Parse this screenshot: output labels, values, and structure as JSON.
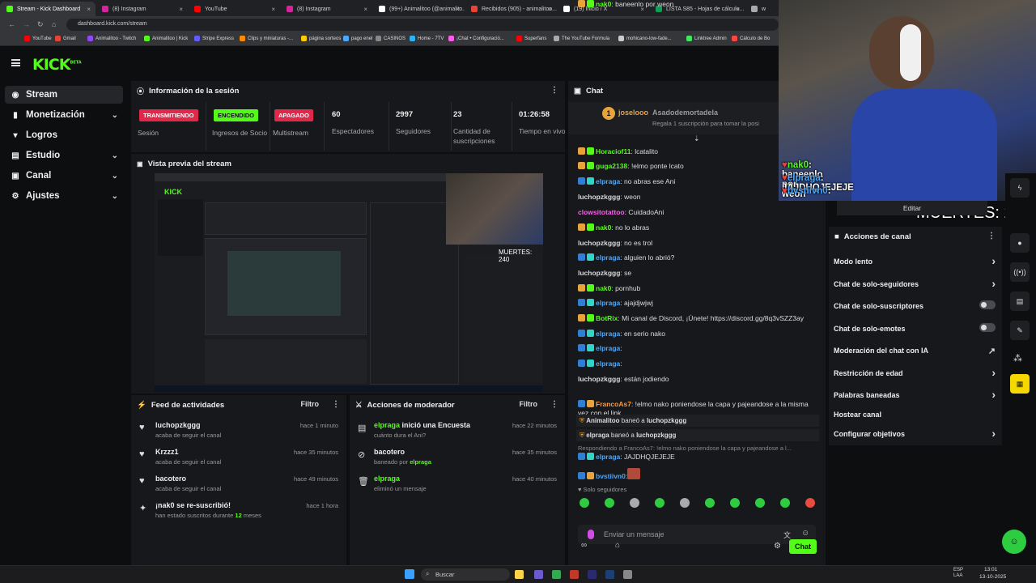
{
  "browser": {
    "tabs": [
      {
        "label": "Stream - Kick Dashboard",
        "color": "#53fc18"
      },
      {
        "label": "(8) Instagram",
        "color": "#d6249f"
      },
      {
        "label": "YouTube",
        "color": "#ff0000"
      },
      {
        "label": "(8) Instagram",
        "color": "#d6249f"
      },
      {
        "label": "(99+) Animalitoo (@animalito...",
        "color": "#ffffff"
      },
      {
        "label": "Recibidos (905) - animalitoo...",
        "color": "#ea4335"
      },
      {
        "label": "(19) Inicio / X",
        "color": "#ffffff"
      },
      {
        "label": "LISTA S85 - Hojas de cálculo...",
        "color": "#0f9d58"
      },
      {
        "label": "w",
        "color": "#aaaaaa"
      }
    ],
    "url": "dashboard.kick.com/stream",
    "bookmarks": [
      "YouTube",
      "Gmail",
      "Animalitoo - Twitch",
      "Animalitoo | Kick",
      "Stripe Express",
      "Clips y miniaturas -...",
      "página sorteos",
      "pago enel",
      "CASINOS",
      "Home - 7TV",
      "¡Chat • Configuració...",
      "Superfans",
      "The YouTube Formula",
      "mohicano-low-fade...",
      "Linktree Admin",
      "Cálculo de Bo"
    ]
  },
  "app": {
    "logo": "KICK",
    "logo_sup": "BETA"
  },
  "sidebar": {
    "items": [
      {
        "label": "Stream",
        "icon": "broadcast-icon"
      },
      {
        "label": "Monetización",
        "icon": "money-icon"
      },
      {
        "label": "Logros",
        "icon": "trophy-icon"
      },
      {
        "label": "Estudio",
        "icon": "studio-icon"
      },
      {
        "label": "Canal",
        "icon": "channel-icon"
      },
      {
        "label": "Ajustes",
        "icon": "gear-icon"
      }
    ]
  },
  "session": {
    "title": "Información de la sesión",
    "badges": [
      {
        "label": "TRANSMITIENDO",
        "sub": "Sesión",
        "bg": "#e0294a"
      },
      {
        "label": "ENCENDIDO",
        "sub": "Ingresos de Socio",
        "bg": "#53fc18"
      },
      {
        "label": "APAGADO",
        "sub": "Multistream",
        "bg": "#e0294a"
      }
    ],
    "stats": [
      {
        "value": "60",
        "label": "Espectadores"
      },
      {
        "value": "2997",
        "label": "Seguidores"
      },
      {
        "value": "23",
        "label": "Cantidad de suscripciones"
      },
      {
        "value": "01:26:58",
        "label": "Tiempo en vivo"
      }
    ]
  },
  "preview": {
    "title": "Vista previa del stream",
    "overlay_text": "MUERTES: 240"
  },
  "feed": {
    "title": "Feed de actividades",
    "filter": "Filtro",
    "items": [
      {
        "name": "luchopzkggg",
        "sub": "acaba de seguir el canal",
        "time": "hace 1 minuto",
        "icon": "heart-icon"
      },
      {
        "name": "Krzzz1",
        "sub": "acaba de seguir el canal",
        "time": "hace 35 minutos",
        "icon": "heart-icon"
      },
      {
        "name": "bacotero",
        "sub": "acaba de seguir el canal",
        "time": "hace 49 minutos",
        "icon": "heart-icon"
      },
      {
        "name": "¡nak0 se re-suscribió!",
        "sub_a": "han estado suscritos durante ",
        "sub_b": "12",
        "sub_c": " meses",
        "time": "hace 1 hora",
        "icon": "star-icon"
      }
    ]
  },
  "modactions": {
    "title": "Acciones de moderador",
    "filter": "Filtro",
    "items": [
      {
        "name": "elpraga",
        "action": " inició una Encuesta",
        "sub": "cuánto dura el Ani?",
        "time": "hace 22 minutos",
        "icon": "poll-icon"
      },
      {
        "name": "bacotero",
        "action": "",
        "sub_a": "baneado por ",
        "sub_b": "elpraga",
        "time": "hace 35 minutos",
        "icon": "ban-icon"
      },
      {
        "name": "elpraga",
        "action": "",
        "sub": "eliminó un mensaje",
        "time": "hace 40 minutos",
        "icon": "trash-icon"
      }
    ]
  },
  "chat": {
    "title": "Chat",
    "pinned": {
      "user": "joselooo",
      "target": "Asadodemortadela",
      "text": "Regala 1 suscripción para tomar la posi"
    },
    "messages": [
      {
        "user": "Horaciof11",
        "color": "#53fc18",
        "text": ": lcatalito"
      },
      {
        "user": "guga2138",
        "color": "#53fc18",
        "text": ": !elmo ponte lcato"
      },
      {
        "user": "elpraga",
        "color": "#4aa8ff",
        "text": ": no abras ese Ani"
      },
      {
        "user": "luchopzkggg",
        "color": "#d8d8d8",
        "text": ": weon"
      },
      {
        "user": "clowsitotattoo",
        "color": "#ff5cf0",
        "text": ": CuidadoAni"
      },
      {
        "user": "nak0",
        "color": "#53fc18",
        "text": ": no lo abras"
      },
      {
        "user": "luchopzkggg",
        "color": "#d8d8d8",
        "text": ": no es trol"
      },
      {
        "user": "elpraga",
        "color": "#4aa8ff",
        "text": ": alguien lo abrió?"
      },
      {
        "user": "luchopzkggg",
        "color": "#d8d8d8",
        "text": ": se"
      },
      {
        "user": "nak0",
        "color": "#53fc18",
        "text": ": pornhub"
      },
      {
        "user": "elpraga",
        "color": "#4aa8ff",
        "text": ": ajajdjwjwj"
      },
      {
        "user": "BotRix",
        "color": "#53fc18",
        "text": ": Mi canal de Discord, ¡Únete! https://discord.gg/8q3vSZZ3ay"
      },
      {
        "user": "elpraga",
        "color": "#4aa8ff",
        "text": ": en serio nako"
      },
      {
        "user": "elpraga",
        "color": "#4aa8ff",
        "text": ":"
      },
      {
        "user": "elpraga",
        "color": "#4aa8ff",
        "text": ":"
      },
      {
        "user": "luchopzkggg",
        "color": "#d8d8d8",
        "text": ": están jodiendo"
      },
      {
        "user": "FrancoAs7",
        "color": "#ff9b3a",
        "text": ": !elmo nako poniendose la capa y pajeandose a la misma vez con el link"
      },
      {
        "user": "nak0",
        "color": "#53fc18",
        "text": ": baneenlo por weon"
      }
    ],
    "mod_rows": [
      {
        "user": "Animalitoo",
        "text": " baneó a ",
        "target": "luchopzkggg"
      },
      {
        "user": "elpraga",
        "text": " baneó a ",
        "target": "luchopzkggg"
      }
    ],
    "reply_text": "Respondiendo a FrancoAs7: !elmo nako poniendose la capa y pajeandose a l...",
    "after_messages": [
      {
        "user": "elpraga",
        "color": "#4aa8ff",
        "text": ": JAJDHQJEJEJE"
      },
      {
        "user": "bvstiivn0",
        "color": "#4aa8ff",
        "text": ":"
      }
    ],
    "mode_label": "Solo seguidores",
    "input_placeholder": "Enviar un mensaje",
    "send_label": "Chat"
  },
  "overlay_chat": [
    {
      "user": "nak0",
      "text": ": baneenlo por weon"
    },
    {
      "user": "elpraga",
      "text": ": JAJDHQJEJEJE"
    },
    {
      "user": "bvstiivn0",
      "text": ":"
    }
  ],
  "overlay_counter": "MUERTES: 240",
  "edit_label": "Editar",
  "channel_actions": {
    "title": "Acciones de canal",
    "items": [
      {
        "label": "Modo lento",
        "control": "arrow"
      },
      {
        "label": "Chat de solo-seguidores",
        "control": "arrow"
      },
      {
        "label": "Chat de solo-suscriptores",
        "control": "toggle"
      },
      {
        "label": "Chat de solo-emotes",
        "control": "toggle"
      },
      {
        "label": "Moderación del chat con IA",
        "control": "external"
      },
      {
        "label": "Restricción de edad",
        "control": "arrow"
      },
      {
        "label": "Palabras baneadas",
        "control": "arrow"
      },
      {
        "label": "Hostear canal",
        "control": "none"
      },
      {
        "label": "Configurar objetivos",
        "control": "arrow"
      }
    ]
  },
  "taskbar": {
    "search": "Buscar",
    "lang": "ESP LAA",
    "time": "13:01",
    "date": "13-10-2025"
  }
}
